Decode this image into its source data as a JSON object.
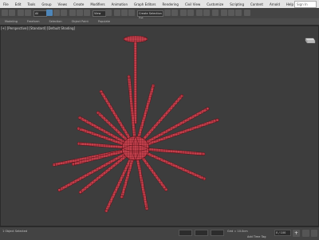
{
  "menubar": {
    "items": [
      "File",
      "Edit",
      "Tools",
      "Group",
      "Views",
      "Create",
      "Modifiers",
      "Animation",
      "Graph Editors",
      "Rendering",
      "Civil View",
      "Customize",
      "Scripting",
      "Content",
      "Arnold",
      "Help"
    ],
    "search_placeholder": "Sign In"
  },
  "toolbar": {
    "selection_filter": "All",
    "view_dropdown": "View",
    "named_selection": "Create Selection Set"
  },
  "ribbon": {
    "tabs": [
      "Modeling",
      "Freeform",
      "Selection",
      "Object Paint",
      "Populate"
    ]
  },
  "viewport": {
    "label": "[+] [Perspective] [Standard] [Default Shading]",
    "model_color": "#c2404c",
    "wire_color": "#5a1018"
  },
  "statusbar": {
    "left_text": "1 Object Selected",
    "grid_label": "Grid = 10.0cm",
    "time_tag": "Add Time Tag",
    "frame_counter": "0 / 100"
  },
  "colors": {
    "menubar_bg": "#e4e4e4",
    "toolbar_bg": "#444444",
    "viewport_bg": "#3d3d3d"
  }
}
